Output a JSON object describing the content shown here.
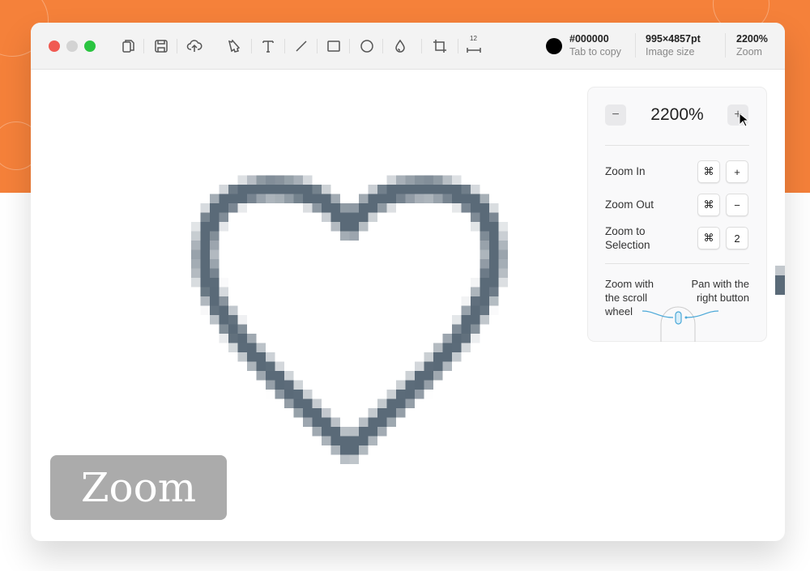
{
  "toolbar": {
    "tools": [
      "copy-icon",
      "save-icon",
      "upload-cloud-icon",
      "pointer-arrow-icon",
      "text-icon",
      "line-icon",
      "rectangle-icon",
      "ellipse-icon",
      "droplet-icon",
      "crop-icon",
      "ruler-icon"
    ],
    "ruler_label": "12",
    "color": {
      "value": "#000000",
      "sub": "Tab to copy"
    },
    "image_size": {
      "value": "995×4857pt",
      "sub": "Image size"
    },
    "zoom": {
      "value": "2200%",
      "sub": "Zoom"
    }
  },
  "zoom_panel": {
    "minus": "−",
    "plus": "+",
    "value": "2200%",
    "shortcuts": [
      {
        "label": "Zoom In",
        "mod": "⌘",
        "key": "+"
      },
      {
        "label": "Zoom Out",
        "mod": "⌘",
        "key": "−"
      },
      {
        "label": "Zoom to Selection",
        "mod": "⌘",
        "key": "2"
      }
    ],
    "scroll_hint": "Zoom with the scroll wheel",
    "pan_hint": "Pan with the right button"
  },
  "badge": "Zoom",
  "colors": {
    "background": "#f5813a",
    "heart": "#5a6a78",
    "accent": "#4aa8d8"
  }
}
